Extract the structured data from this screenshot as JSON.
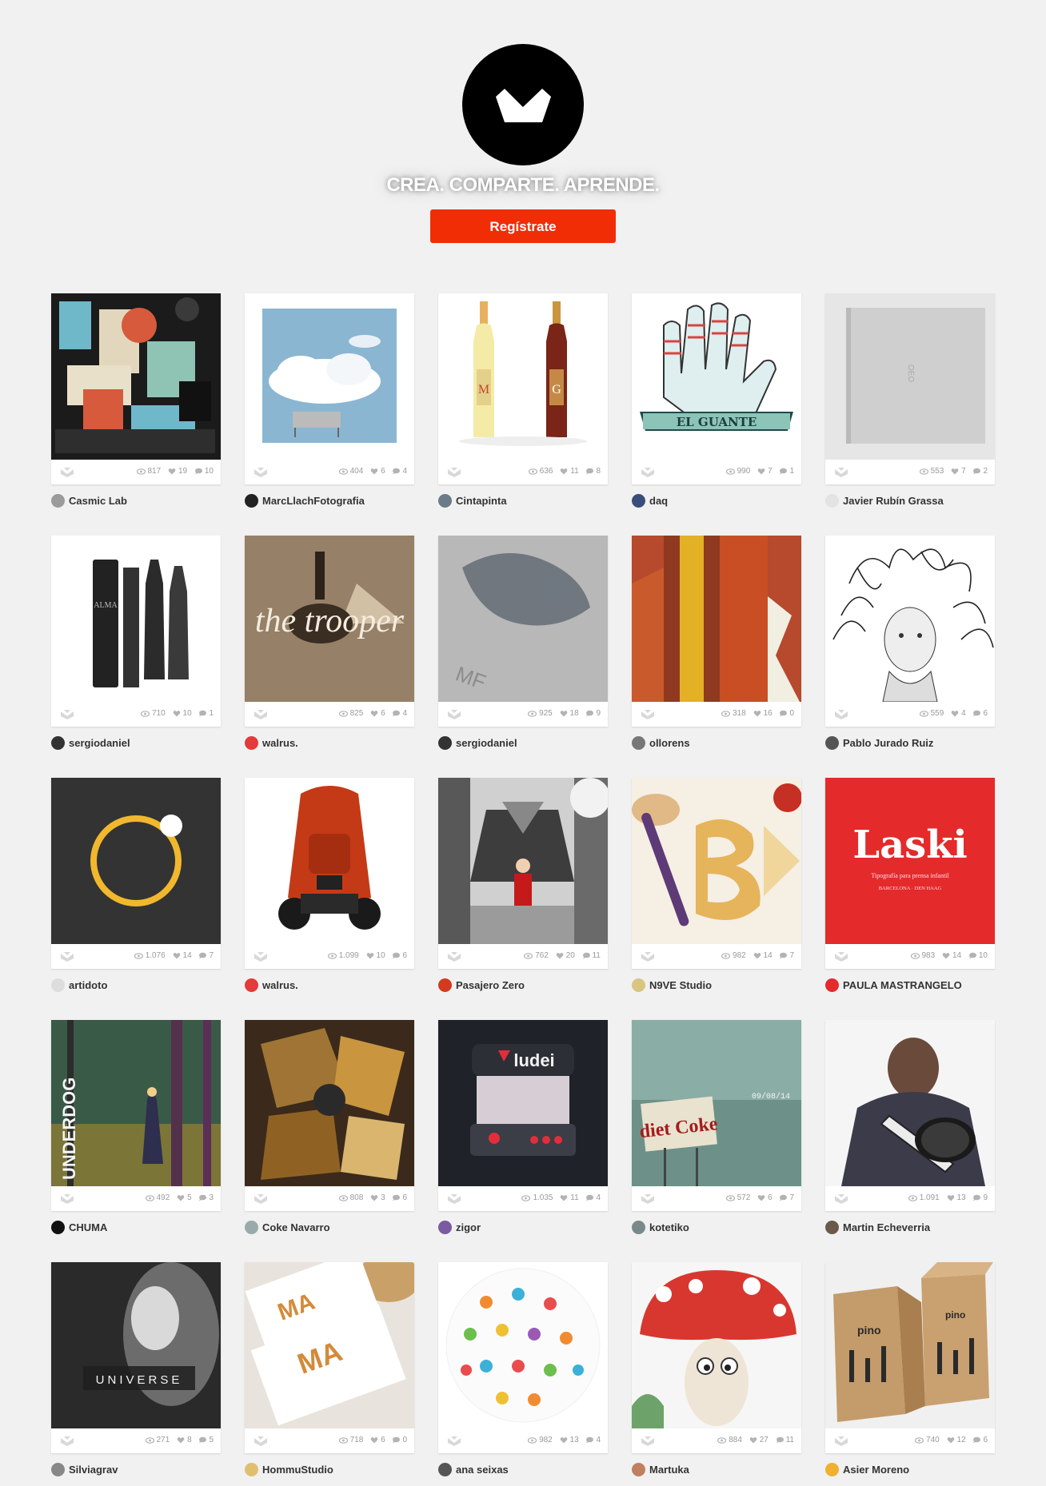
{
  "header": {
    "tagline": "CREA. COMPARTE. APRENDE.",
    "cta_label": "Regístrate"
  },
  "projects": [
    {
      "author": "Casmic Lab",
      "views": "817",
      "likes": "19",
      "comments": "10",
      "icon": "casmic-city-illustration"
    },
    {
      "author": "MarcLlachFotografia",
      "views": "404",
      "likes": "6",
      "comments": "4",
      "icon": "sky-billboard-photo"
    },
    {
      "author": "Cintapinta",
      "views": "636",
      "likes": "11",
      "comments": "8",
      "icon": "wine-bottles"
    },
    {
      "author": "daq",
      "views": "990",
      "likes": "7",
      "comments": "1",
      "icon": "glove-illustration",
      "thumb_text": "EL GUANTE"
    },
    {
      "author": "Javier Rubín Grassa",
      "views": "553",
      "likes": "7",
      "comments": "2",
      "icon": "grey-book"
    },
    {
      "author": "sergiodaniel",
      "views": "710",
      "likes": "10",
      "comments": "1",
      "icon": "black-bottles",
      "thumb_text": "ALMA"
    },
    {
      "author": "walrus.",
      "views": "825",
      "likes": "6",
      "comments": "4",
      "icon": "trooper-poster",
      "thumb_text": "the trooper"
    },
    {
      "author": "sergiodaniel",
      "views": "925",
      "likes": "18",
      "comments": "9",
      "icon": "grey-embossed-print",
      "thumb_text": "MF"
    },
    {
      "author": "ollorens",
      "views": "318",
      "likes": "16",
      "comments": "0",
      "icon": "red-figure-illustration"
    },
    {
      "author": "Pablo Jurado Ruiz",
      "views": "559",
      "likes": "4",
      "comments": "6",
      "icon": "medusa-drawing"
    },
    {
      "author": "artidoto",
      "views": "1.076",
      "likes": "14",
      "comments": "7",
      "icon": "yellow-ring"
    },
    {
      "author": "walrus.",
      "views": "1.099",
      "likes": "10",
      "comments": "6",
      "icon": "vacuum-cleaner"
    },
    {
      "author": "Pasajero Zero",
      "views": "762",
      "likes": "20",
      "comments": "11",
      "icon": "red-riding-hood"
    },
    {
      "author": "N9VE Studio",
      "views": "982",
      "likes": "14",
      "comments": "7",
      "icon": "bread-letters"
    },
    {
      "author": "PAULA MASTRANGELO",
      "views": "983",
      "likes": "14",
      "comments": "10",
      "icon": "laski-poster",
      "thumb_text": "Laski",
      "thumb_sub": "Tipografía para prensa infantil",
      "thumb_sub2": "BARCELONA · DEN HAAG"
    },
    {
      "author": "CHUMA",
      "views": "492",
      "likes": "5",
      "comments": "3",
      "icon": "underdog-forest",
      "thumb_text": "UNDERDOG"
    },
    {
      "author": "Coke Navarro",
      "views": "808",
      "likes": "3",
      "comments": "6",
      "icon": "room-collage"
    },
    {
      "author": "zigor",
      "views": "1.035",
      "likes": "11",
      "comments": "4",
      "icon": "arcade-machine",
      "thumb_text": "ludei"
    },
    {
      "author": "kotetiko",
      "views": "572",
      "likes": "6",
      "comments": "7",
      "icon": "diet-coke-sign",
      "thumb_text": "diet Coke",
      "thumb_sub": "09/08/14"
    },
    {
      "author": "Martin Echeverria",
      "views": "1.091",
      "likes": "13",
      "comments": "9",
      "icon": "guitar-player-drawing"
    },
    {
      "author": "Silviagrav",
      "views": "271",
      "likes": "8",
      "comments": "5",
      "icon": "universe-portrait",
      "thumb_text": "UNIVERSE"
    },
    {
      "author": "HommuStudio",
      "views": "718",
      "likes": "6",
      "comments": "0",
      "icon": "cards-cookie",
      "thumb_text": "MA"
    },
    {
      "author": "ana seixas",
      "views": "982",
      "likes": "13",
      "comments": "4",
      "icon": "kids-pattern-circle"
    },
    {
      "author": "Martuka",
      "views": "884",
      "likes": "27",
      "comments": "11",
      "icon": "mushroom-character"
    },
    {
      "author": "Asier Moreno",
      "views": "740",
      "likes": "12",
      "comments": "6",
      "icon": "kraft-boxes",
      "thumb_text": "pino"
    }
  ]
}
